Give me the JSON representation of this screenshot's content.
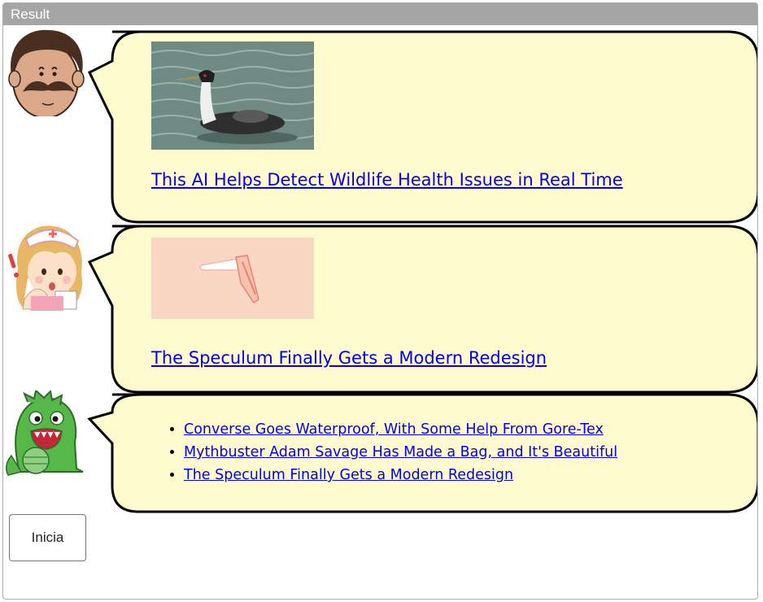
{
  "window": {
    "title": "Result"
  },
  "messages": [
    {
      "headline": "This AI Helps Detect Wildlife Health Issues in Real Time",
      "image": "grebe-with-chicks-photo",
      "avatar": "mustache-man-avatar"
    },
    {
      "headline": "The Speculum Finally Gets a Modern Redesign",
      "image": "speculum-illustration",
      "avatar": "nurse-avatar"
    },
    {
      "links": [
        "Converse Goes Waterproof, With Some Help From Gore-Tex",
        "Mythbuster Adam Savage Has Made a Bag, and It's Beautiful",
        "The Speculum Finally Gets a Modern Redesign"
      ],
      "avatar": "green-monster-avatar"
    }
  ],
  "start_button": {
    "label": "Inicia"
  },
  "colors": {
    "bubble_fill": "#fffbcf",
    "link": "#0000ee",
    "titlebar": "#a5a5a5"
  }
}
